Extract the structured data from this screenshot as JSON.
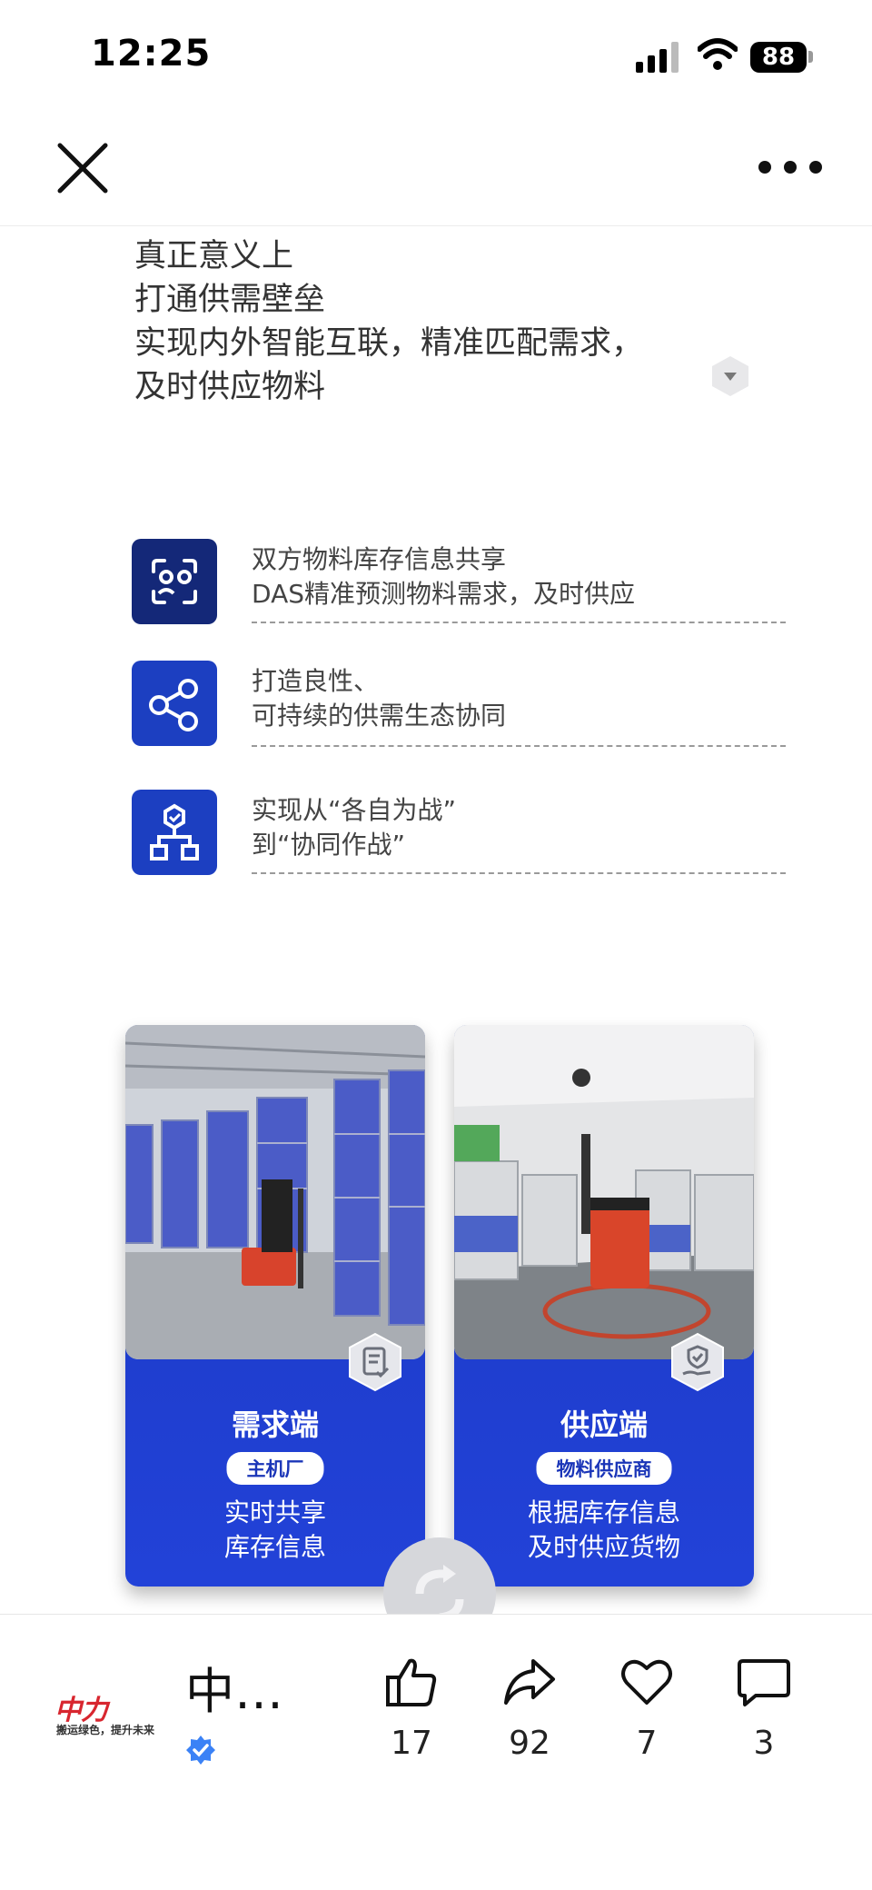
{
  "status_bar": {
    "time": "12:25",
    "battery": "88"
  },
  "nav": {
    "close_icon": "close-icon",
    "more_icon": "more-icon"
  },
  "intro": {
    "lines": [
      "真正意义上",
      "打通供需壁垒",
      "实现内外智能互联，精准匹配需求，",
      "及时供应物料"
    ]
  },
  "features": [
    {
      "icon": "face-scan-icon",
      "line1": "双方物料库存信息共享",
      "line2": "DAS精准预测物料需求，及时供应",
      "icon_color": "#142878"
    },
    {
      "icon": "share-nodes-icon",
      "line1": "打造良性、",
      "line2": "可持续的供需生态协同",
      "icon_color": "#1d3fc6"
    },
    {
      "icon": "org-chart-icon",
      "line1": "实现从“各自为战”",
      "line2": "到“协同作战”",
      "icon_color": "#1d3fc6"
    }
  ],
  "cards": [
    {
      "title": "需求端",
      "tag": "主机厂",
      "desc1": "实时共享",
      "desc2": "库存信息",
      "badge_icon": "document-check-icon"
    },
    {
      "title": "供应端",
      "tag": "物料供应商",
      "desc1": "根据库存信息",
      "desc2": "及时供应货物",
      "badge_icon": "hand-shield-icon"
    }
  ],
  "bottom": {
    "logo_text": "中力",
    "logo_tagline": "搬运绿色，提升未来",
    "author": "中…",
    "actions": [
      {
        "name": "like",
        "icon": "thumbs-up-icon",
        "count": "17"
      },
      {
        "name": "share",
        "icon": "share-arrow-icon",
        "count": "92"
      },
      {
        "name": "favorite",
        "icon": "heart-icon",
        "count": "7"
      },
      {
        "name": "comment",
        "icon": "comment-bubble-icon",
        "count": "3"
      }
    ]
  },
  "colors": {
    "brand_blue": "#1d3fc6",
    "dark_blue": "#142878",
    "logo_red": "#d8262f",
    "verified_blue": "#3b82f6"
  }
}
